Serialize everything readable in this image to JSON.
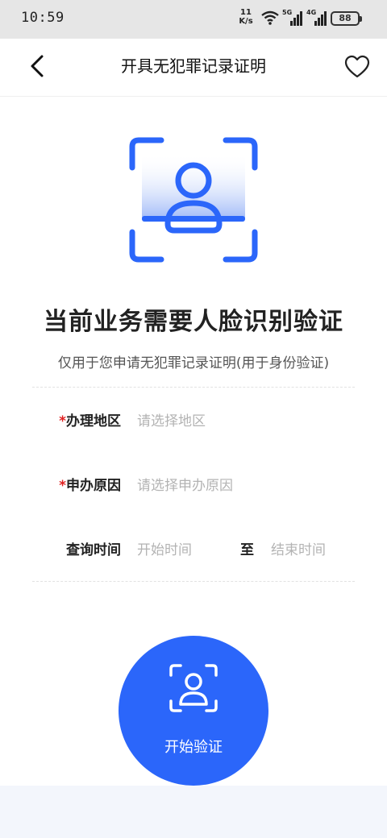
{
  "status_bar": {
    "time": "10:59",
    "net_speed_value": "11",
    "net_speed_unit": "K/s",
    "net1_label": "5G",
    "net2_label": "4G",
    "battery": "88"
  },
  "nav": {
    "title": "开具无犯罪记录证明",
    "back_icon": "chevron-left-icon",
    "favorite_icon": "heart-outline-icon"
  },
  "hero": {
    "icon": "face-scan-icon",
    "headline": "当前业务需要人脸识别验证",
    "subline": "仅用于您申请无犯罪记录证明(用于身份验证)"
  },
  "form": {
    "region": {
      "required_mark": "*",
      "label": "办理地区",
      "placeholder": "请选择地区"
    },
    "reason": {
      "required_mark": "*",
      "label": "申办原因",
      "placeholder": "请选择申办原因"
    },
    "time": {
      "label": "查询时间",
      "start_placeholder": "开始时间",
      "to": "至",
      "end_placeholder": "结束时间"
    }
  },
  "action": {
    "start_label": "开始验证",
    "icon": "face-scan-icon"
  },
  "colors": {
    "accent": "#2b66fa",
    "required": "#e02020",
    "placeholder": "#b3b3b3"
  }
}
